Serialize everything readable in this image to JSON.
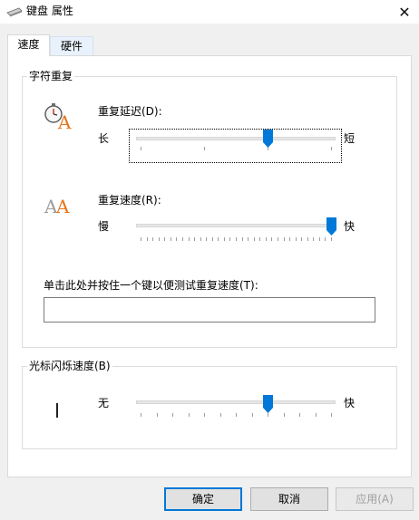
{
  "window": {
    "title": "键盘 属性",
    "close_glyph": "✕"
  },
  "tabs": [
    {
      "label": "速度"
    },
    {
      "label": "硬件"
    }
  ],
  "char_repeat": {
    "title": "字符重复",
    "delay": {
      "label": "重复延迟(D):",
      "mnemonic": "D",
      "min_label": "长",
      "max_label": "短",
      "ticks": 4,
      "value": 2
    },
    "rate": {
      "label": "重复速度(R):",
      "mnemonic": "R",
      "min_label": "慢",
      "max_label": "快",
      "ticks": 33,
      "value": 32
    },
    "test_label": "单击此处并按住一个键以便测试重复速度(T):",
    "test_mnemonic": "T",
    "test_value": ""
  },
  "cursor_blink": {
    "title": "光标闪烁速度(B)",
    "mnemonic": "B",
    "min_label": "无",
    "max_label": "快",
    "ticks": 13,
    "value": 8
  },
  "buttons": {
    "ok": "确定",
    "cancel": "取消",
    "apply": "应用(A)"
  },
  "colors": {
    "accent": "#0078d7",
    "icon_orange": "#e8751a"
  },
  "icons": {
    "title": "keyboard-icon",
    "delay": "stopwatch-letter-icon",
    "rate": "double-letter-icon",
    "cursor": "text-cursor-icon"
  }
}
